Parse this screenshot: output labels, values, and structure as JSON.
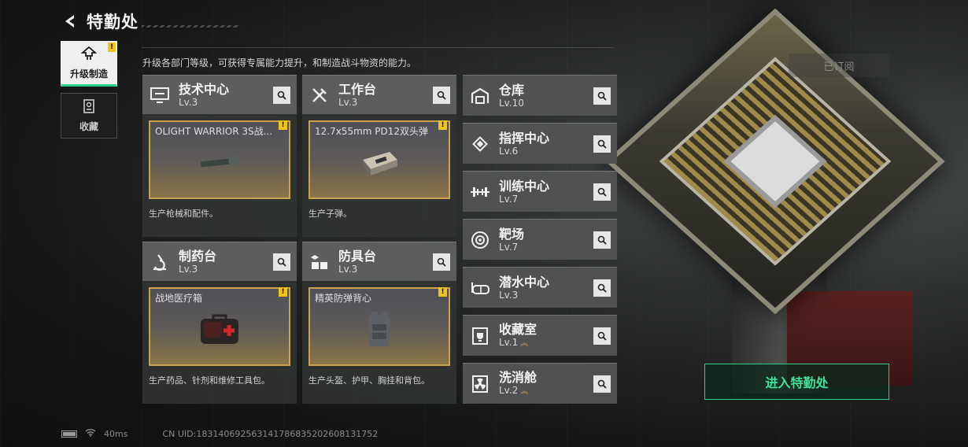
{
  "header": {
    "title": "特勤处"
  },
  "nav": {
    "tabs": [
      {
        "label": "升级制造",
        "icon": "upgrade-icon"
      },
      {
        "label": "收藏",
        "icon": "collection-icon"
      }
    ]
  },
  "subtitle": "升级各部门等级，可获得专属能力提升，和制造战斗物资的能力。",
  "subscribe_label": "已订阅",
  "cards": [
    {
      "name": "技术中心",
      "level": "Lv.3",
      "icon": "computer-icon",
      "item": "OLIGHT WARRIOR 3S战...",
      "desc": "生产枪械和配件。"
    },
    {
      "name": "工作台",
      "level": "Lv.3",
      "icon": "tools-icon",
      "item": "12.7x55mm PD12双头弹",
      "desc": "生产子弹。"
    },
    {
      "name": "制药台",
      "level": "Lv.3",
      "icon": "microscope-icon",
      "item": "战地医疗箱",
      "desc": "生产药品、针剂和维修工具包。"
    },
    {
      "name": "防具台",
      "level": "Lv.3",
      "icon": "cubes-icon",
      "item": "精英防弹背心",
      "desc": "生产头盔、护甲、胸挂和背包。"
    }
  ],
  "facilities": [
    {
      "name": "仓库",
      "level": "Lv.10",
      "icon": "warehouse-icon",
      "upgradable": false
    },
    {
      "name": "指挥中心",
      "level": "Lv.6",
      "icon": "chip-icon",
      "upgradable": false
    },
    {
      "name": "训练中心",
      "level": "Lv.7",
      "icon": "dumbbell-icon",
      "upgradable": false
    },
    {
      "name": "靶场",
      "level": "Lv.7",
      "icon": "target-icon",
      "upgradable": false
    },
    {
      "name": "潜水中心",
      "level": "Lv.3",
      "icon": "diving-mask-icon",
      "upgradable": false
    },
    {
      "name": "收藏室",
      "level": "Lv.1",
      "icon": "trophy-icon",
      "upgradable": true
    },
    {
      "name": "洗消舱",
      "level": "Lv.2",
      "icon": "radiation-icon",
      "upgradable": true
    }
  ],
  "enter_button": "进入特勤处",
  "footer": {
    "ping": "40ms",
    "uid": "CN UID:18314069256314178683520260813175​2"
  },
  "colors": {
    "accent": "#2bd18a",
    "warning": "#f0c21a",
    "item_border": "#c8a24c"
  }
}
